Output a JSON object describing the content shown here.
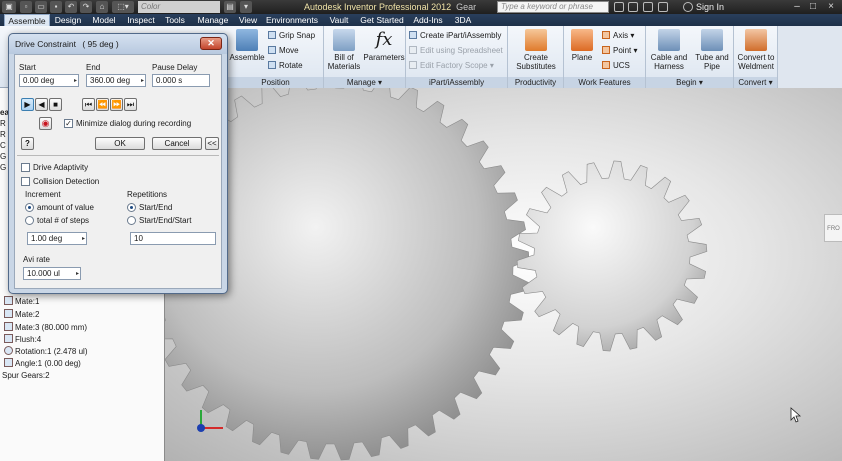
{
  "title_bar": {
    "app_title": "Autodesk Inventor Professional 2012",
    "document": "Gear",
    "color_box": "Color",
    "search_placeholder": "Type a keyword or phrase",
    "sign_in": "Sign In"
  },
  "tabs": [
    "Assemble",
    "Design",
    "Model",
    "Inspect",
    "Tools",
    "Manage",
    "View",
    "Environments",
    "Vault",
    "Get Started",
    "Add-Ins",
    "3DA"
  ],
  "ribbon": {
    "assemble_label": "Assemble",
    "position": {
      "grip_snap": "Grip Snap",
      "move": "Move",
      "rotate": "Rotate",
      "group": "Position"
    },
    "manage": {
      "bom": "Bill of\nMaterials",
      "parameters": "Parameters",
      "group": "Manage ▾"
    },
    "ipart": {
      "create": "Create iPart/iAssembly",
      "edit_spreadsheet": "Edit using Spreadsheet",
      "edit_scope": "Edit Factory Scope",
      "group": "iPart/iAssembly"
    },
    "productivity": {
      "create_sub": "Create\nSubstitutes",
      "group": "Productivity"
    },
    "work": {
      "plane": "Plane",
      "axis": "Axis",
      "point": "Point",
      "ucs": "UCS",
      "group": "Work Features"
    },
    "begin": {
      "cable": "Cable and\nHarness",
      "tube": "Tube and\nPipe",
      "group": "Begin ▾"
    },
    "convert": {
      "weldment": "Convert to\nWeldment",
      "group": "Convert ▾"
    }
  },
  "dialog": {
    "title": "Drive Constraint",
    "title_value": "( 95 deg )",
    "start_label": "Start",
    "start_value": "0.00 deg",
    "end_label": "End",
    "end_value": "360.00 deg",
    "pause_label": "Pause Delay",
    "pause_value": "0.000 s",
    "minimize_label": "Minimize dialog during recording",
    "ok": "OK",
    "cancel": "Cancel",
    "expand": "<<",
    "help": "?",
    "drive_adaptivity": "Drive Adaptivity",
    "collision_detection": "Collision Detection",
    "increment_label": "Increment",
    "amount_of_value": "amount of value",
    "total_steps": "total # of steps",
    "increment_value": "1.00 deg",
    "repetitions_label": "Repetitions",
    "start_end": "Start/End",
    "start_end_start": "Start/End/Start",
    "repetitions_value": "10",
    "avi_rate_label": "Avi rate",
    "avi_rate_value": "10.000 ul"
  },
  "browser": {
    "items": [
      "Mate:1",
      "Mate:2",
      "Mate:3 (80.000 mm)",
      "Flush:4",
      "Rotation:1 (2.478 ul)",
      "Angle:1 (0.00 deg)",
      "Spur Gears:2"
    ],
    "partial_left": [
      "ea",
      "R",
      "R",
      "C",
      "G",
      "G"
    ]
  },
  "viewcube_label": "FRO",
  "colors": {
    "tab_bar": "#1e3048",
    "ribbon": "#e4ebf4",
    "dialog_frame": "#c9d6e6",
    "close_button": "#c3452c"
  }
}
